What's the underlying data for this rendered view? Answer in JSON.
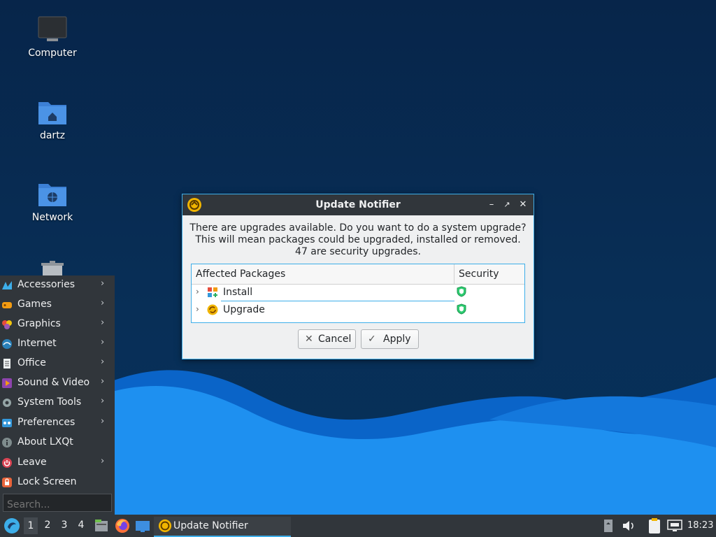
{
  "desktop": {
    "icons": [
      {
        "label": "Computer",
        "icon": "computer-icon"
      },
      {
        "label": "dartz",
        "icon": "home-folder-icon"
      },
      {
        "label": "Network",
        "icon": "network-folder-icon"
      },
      {
        "label": "",
        "icon": "trash-icon"
      }
    ],
    "colors": {
      "background": "#07254a",
      "wave_light": "#1e90f0",
      "wave_dark": "#0a64c8"
    }
  },
  "dialog": {
    "title": "Update Notifier",
    "app_icon": "update-notifier-icon",
    "message_lines": [
      "There are upgrades available. Do you want to do a system upgrade?",
      "This will mean packages could be upgraded, installed or removed.",
      "47 are security upgrades."
    ],
    "table": {
      "headers": [
        "Affected Packages",
        "Security"
      ],
      "rows": [
        {
          "name": "Install",
          "icon": "install-icon",
          "security": "shield-icon"
        },
        {
          "name": "Upgrade",
          "icon": "upgrade-icon",
          "security": "shield-icon"
        }
      ]
    },
    "buttons": {
      "cancel": "Cancel",
      "apply": "Apply"
    },
    "accent": "#3daee9"
  },
  "menu": {
    "items": [
      {
        "label": "Accessories",
        "icon": "accessories-icon",
        "submenu": true
      },
      {
        "label": "Games",
        "icon": "games-icon",
        "submenu": true
      },
      {
        "label": "Graphics",
        "icon": "graphics-icon",
        "submenu": true
      },
      {
        "label": "Internet",
        "icon": "internet-icon",
        "submenu": true
      },
      {
        "label": "Office",
        "icon": "office-icon",
        "submenu": true
      },
      {
        "label": "Sound & Video",
        "icon": "sound-video-icon",
        "submenu": true
      },
      {
        "label": "System Tools",
        "icon": "system-tools-icon",
        "submenu": true
      },
      {
        "label": "Preferences",
        "icon": "preferences-icon",
        "submenu": true
      },
      {
        "label": "About LXQt",
        "icon": "info-icon",
        "submenu": false
      },
      {
        "label": "Leave",
        "icon": "power-icon",
        "submenu": true
      },
      {
        "label": "Lock Screen",
        "icon": "lock-icon",
        "submenu": false
      }
    ],
    "search_placeholder": "Search..."
  },
  "taskbar": {
    "workspaces": [
      "1",
      "2",
      "3",
      "4"
    ],
    "active_workspace": "1",
    "task": "Update Notifier",
    "clock": "18:23"
  }
}
